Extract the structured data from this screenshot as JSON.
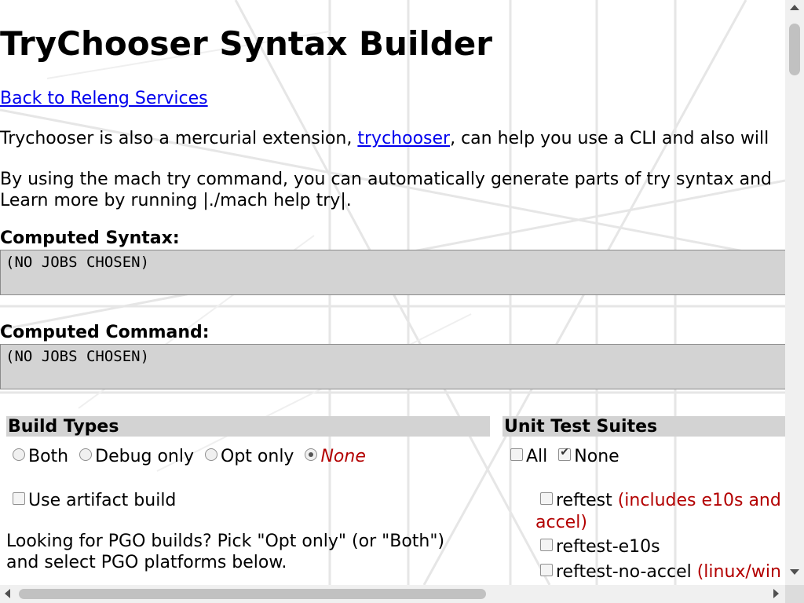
{
  "page": {
    "title": "TryChooser Syntax Builder",
    "back_link": "Back to Releng Services",
    "intro1_before": "Trychooser is also a mercurial extension, ",
    "intro1_link": "trychooser",
    "intro1_after": ", can help you use a CLI and also will",
    "intro2_line1": "By using the mach try command, you can automatically generate parts of try syntax and",
    "intro2_line2": "Learn more by running |./mach help try|."
  },
  "computed": {
    "syntax_label": "Computed Syntax:",
    "syntax_value": "(NO JOBS CHOSEN)",
    "command_label": "Computed Command:",
    "command_value": "(NO JOBS CHOSEN)"
  },
  "build_types": {
    "heading": "Build Types",
    "options": [
      "Both",
      "Debug only",
      "Opt only",
      "None"
    ],
    "selected": "None",
    "artifact_label": "Use artifact build",
    "pgo_line1": "Looking for PGO builds? Pick \"Opt only\" (or \"Both\")",
    "pgo_line2": "and select PGO platforms below."
  },
  "unit_tests": {
    "heading": "Unit Test Suites",
    "all_label": "All",
    "none_label": "None",
    "items": [
      {
        "label": "reftest",
        "note": "(includes e10s and",
        "note2": "accel)"
      },
      {
        "label": "reftest-e10s",
        "note": ""
      },
      {
        "label": "reftest-no-accel",
        "note": "(linux/win"
      }
    ]
  },
  "colors": {
    "link": "#0000ee",
    "note_red": "#b30000",
    "section_bg": "#d3d3d3"
  }
}
